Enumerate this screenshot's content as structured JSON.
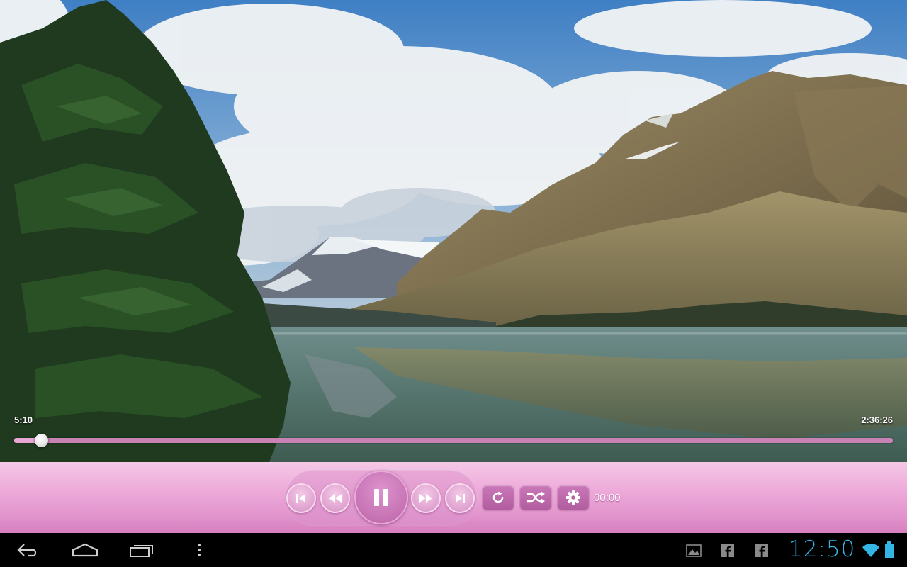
{
  "player": {
    "elapsed": "5:10",
    "duration": "2:36:26",
    "progress_fraction": 0.0307,
    "position_readout": "00:00"
  },
  "controls": {
    "prev_icon": "skip-previous-icon",
    "rewind_icon": "rewind-icon",
    "play_pause_icon": "pause-icon",
    "fast_forward_icon": "fast-forward-icon",
    "next_icon": "skip-next-icon",
    "repeat_icon": "repeat-icon",
    "shuffle_icon": "shuffle-icon",
    "settings_icon": "gear-icon"
  },
  "system_bar": {
    "clock": "12:50",
    "nav_icons": [
      "back-icon",
      "home-icon",
      "recent-apps-icon",
      "overflow-menu-icon"
    ],
    "notification_icons": [
      "gallery-icon",
      "facebook-icon",
      "facebook-icon"
    ]
  },
  "colors": {
    "control_bar": "#eeaedb",
    "seek_track": "#c882b4",
    "clock": "#33b5e5"
  }
}
